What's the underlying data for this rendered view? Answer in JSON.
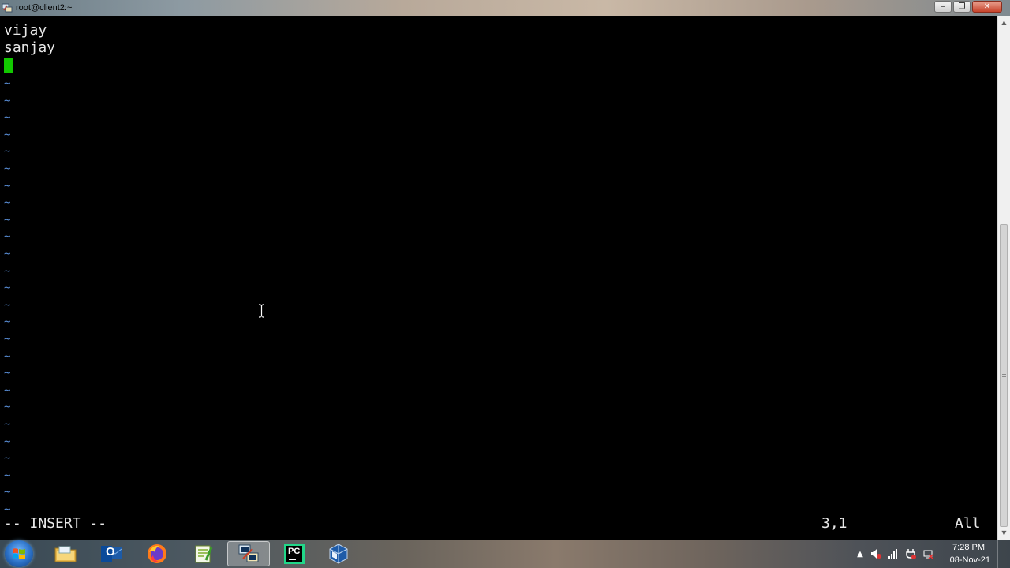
{
  "window": {
    "title": "root@client2:~",
    "controls": [
      "minimize",
      "maximize",
      "close"
    ]
  },
  "terminal": {
    "lines": [
      "vijay",
      "sanjay"
    ],
    "empty_line_marker": "~",
    "status_mode": "-- INSERT --",
    "status_position": "3,1",
    "status_scroll": "All"
  },
  "taskbar": {
    "apps": [
      {
        "name": "windows-explorer",
        "icon": "folder-icon"
      },
      {
        "name": "outlook",
        "icon": "outlook-icon"
      },
      {
        "name": "firefox",
        "icon": "firefox-icon"
      },
      {
        "name": "notepad-plus-plus",
        "icon": "notepad-icon"
      },
      {
        "name": "putty",
        "icon": "putty-icon",
        "active": true
      },
      {
        "name": "pycharm",
        "icon": "pycharm-icon",
        "label": "PC"
      },
      {
        "name": "virtualbox",
        "icon": "virtualbox-icon"
      }
    ],
    "outlook_label": "O",
    "clock": {
      "time": "7:28 PM",
      "date": "08-Nov-21"
    }
  },
  "colors": {
    "terminal_bg": "#000000",
    "cursor": "#12c800",
    "tilde": "#5a8fd8",
    "text": "#e8e8e8"
  }
}
